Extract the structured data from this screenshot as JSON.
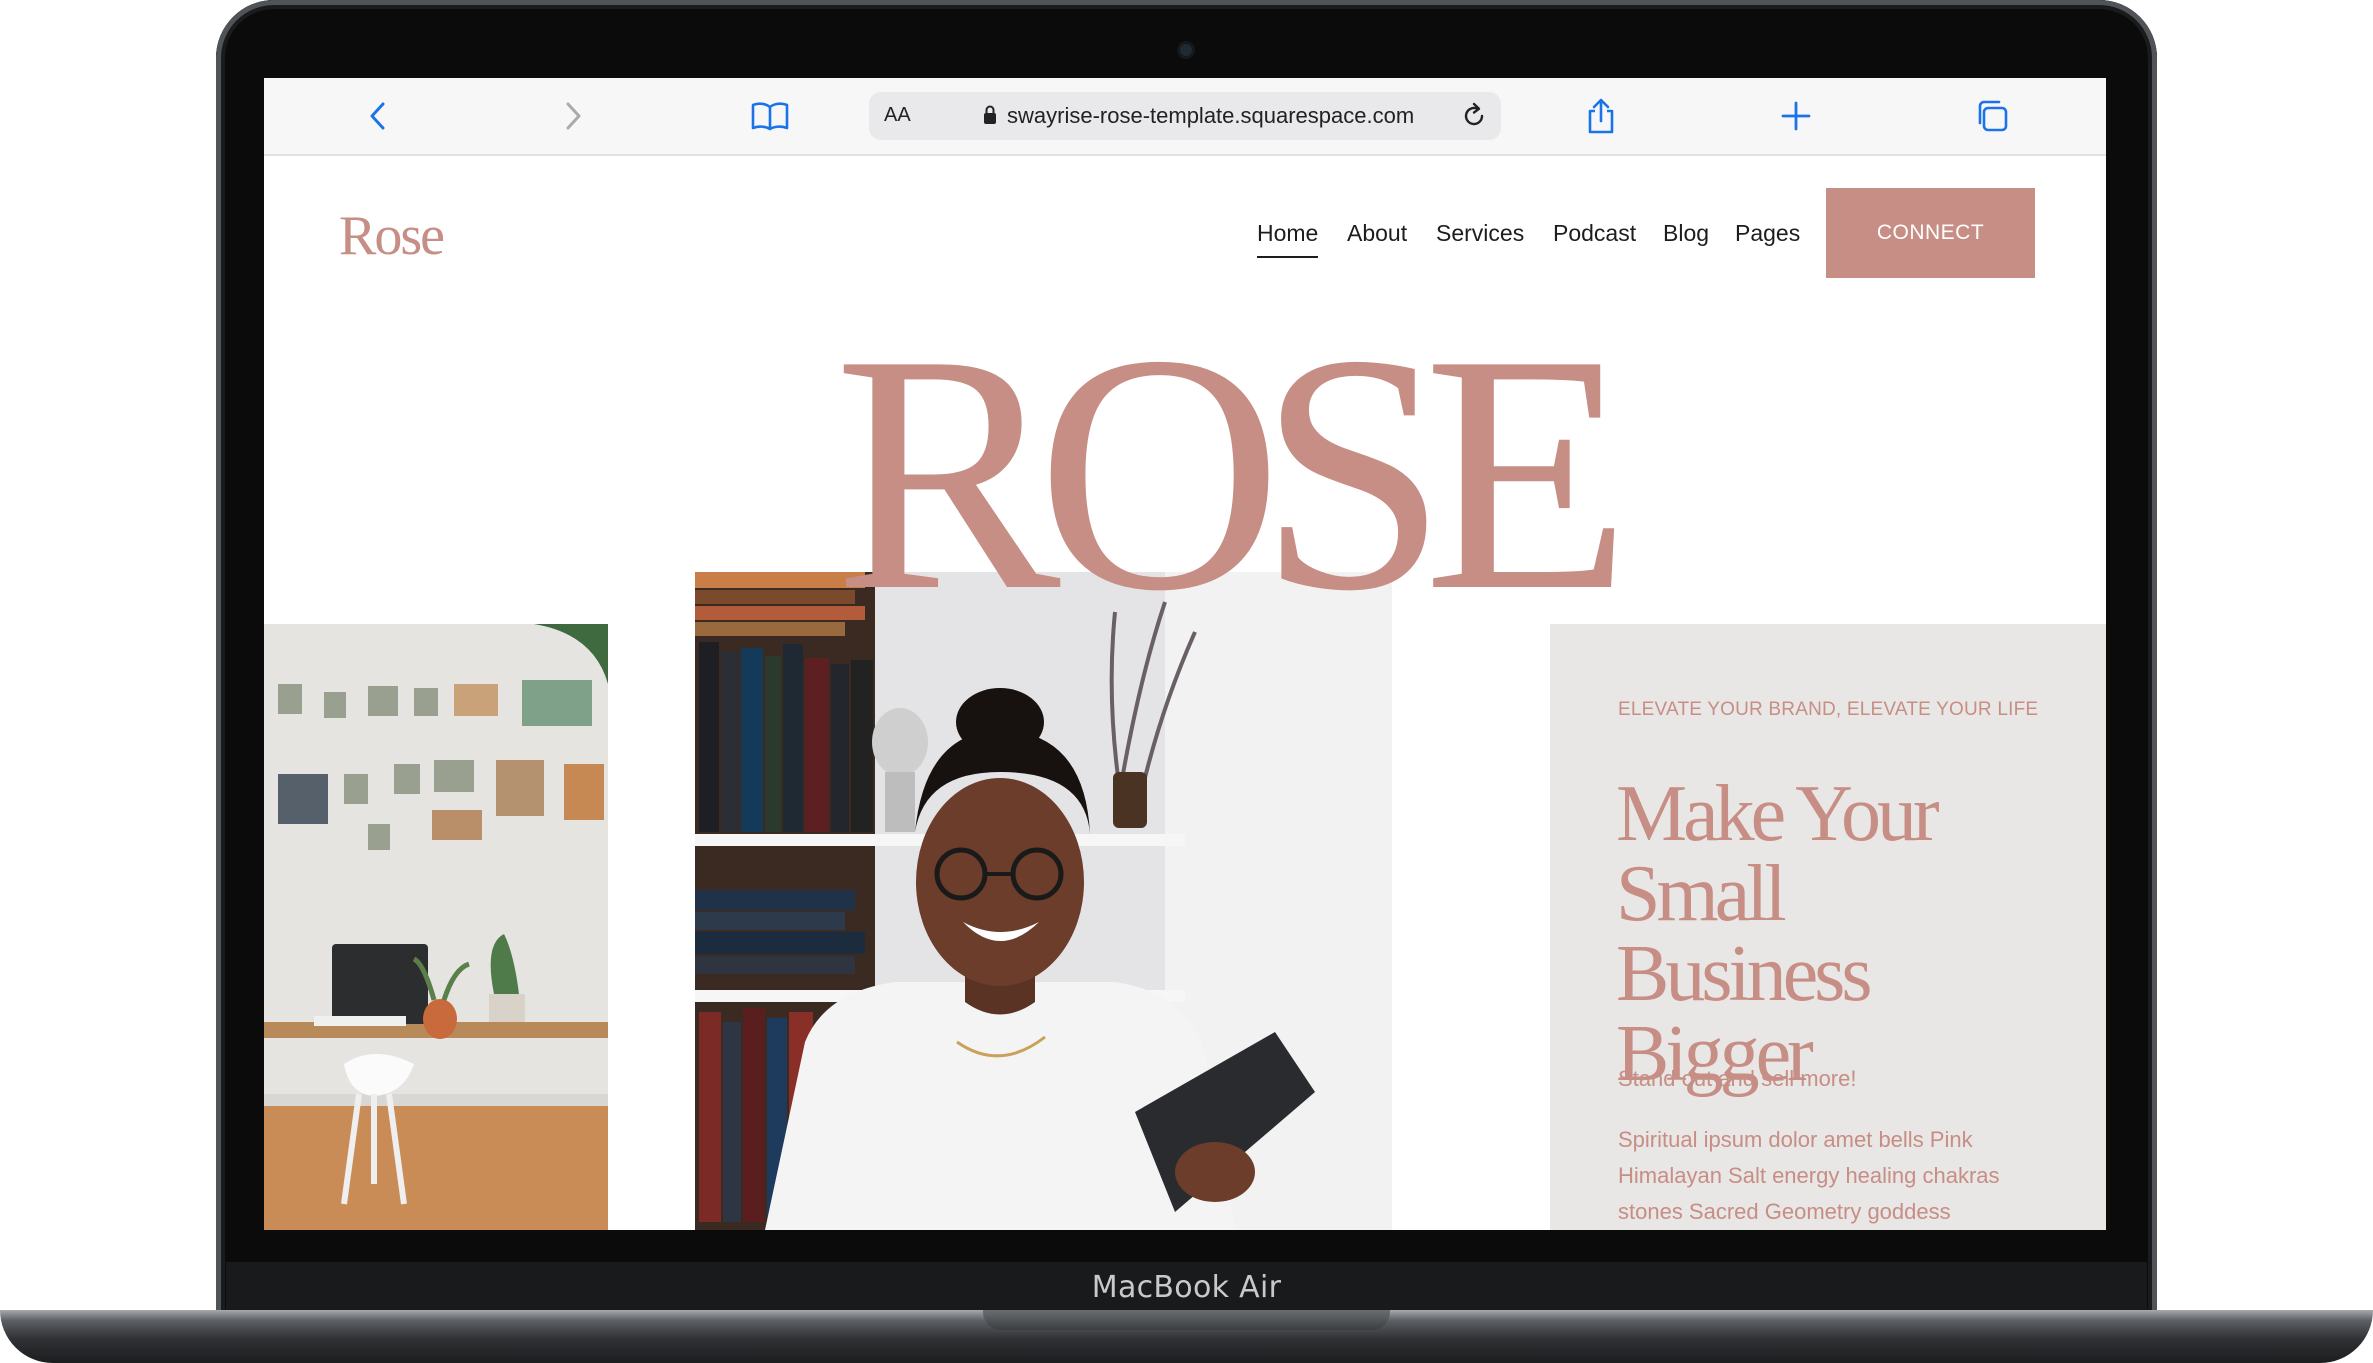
{
  "device": {
    "label": "MacBook Air"
  },
  "browser": {
    "text_size_label": "AA",
    "url": "swayrise-rose-template.squarespace.com",
    "icons": [
      "chevron-left-icon",
      "chevron-right-icon",
      "book-icon",
      "lock-icon",
      "reload-icon",
      "share-icon",
      "plus-icon",
      "tabs-icon"
    ]
  },
  "site": {
    "logo": "Rose",
    "nav": [
      {
        "label": "Home",
        "active": true
      },
      {
        "label": "About"
      },
      {
        "label": "Services"
      },
      {
        "label": "Podcast"
      },
      {
        "label": "Blog"
      },
      {
        "label": "Pages"
      }
    ],
    "cta": "CONNECT",
    "hero_title": "ROSE",
    "panel": {
      "eyebrow": "ELEVATE YOUR BRAND, ELEVATE YOUR LIFE",
      "headline": "Make Your Small Business Bigger",
      "tagline": "Stand out and sell more!",
      "body": "Spiritual ipsum dolor amet bells Pink Himalayan Salt energy healing chakras stones Sacred Geometry goddess"
    },
    "colors": {
      "accent": "#c68e84",
      "panel_bg": "#e9e6e6",
      "text": "#1d1d1d"
    }
  }
}
